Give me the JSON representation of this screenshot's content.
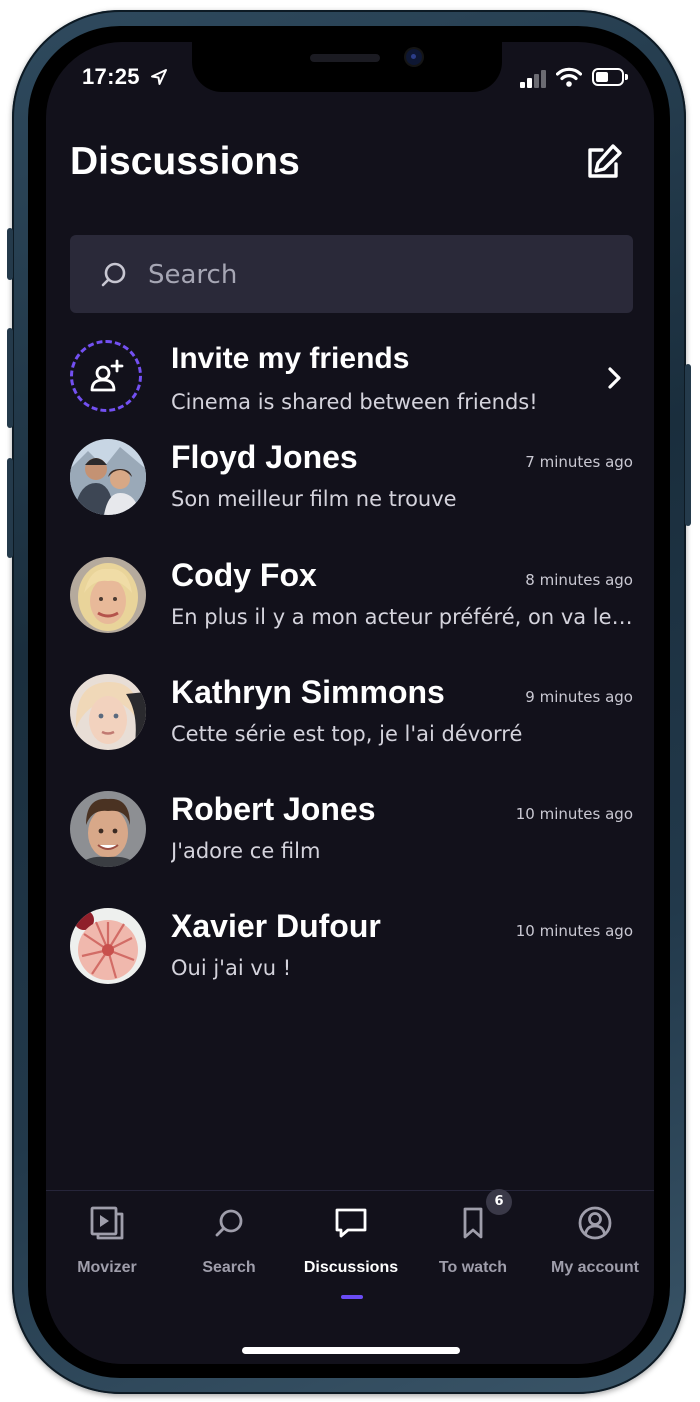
{
  "status_bar": {
    "time": "17:25"
  },
  "header": {
    "title": "Discussions"
  },
  "search": {
    "placeholder": "Search"
  },
  "invite": {
    "title": "Invite my friends",
    "subtitle": "Cinema is shared between friends!"
  },
  "conversations": [
    {
      "name": "Floyd Jones",
      "time": "7 minutes ago",
      "message": "Son meilleur film ne trouve"
    },
    {
      "name": "Cody Fox",
      "time": "8 minutes ago",
      "message": "En plus il y a mon acteur préféré, on va le voir ensemble ?"
    },
    {
      "name": "Kathryn Simmons",
      "time": "9 minutes ago",
      "message": "Cette série est top, je l'ai dévorré"
    },
    {
      "name": "Robert Jones",
      "time": "10 minutes ago",
      "message": "J'adore ce film"
    },
    {
      "name": "Xavier Dufour",
      "time": "10 minutes ago",
      "message": "Oui j'ai vu !"
    }
  ],
  "tabbar": {
    "tabs": [
      {
        "label": "Movizer",
        "icon": "play-square-icon"
      },
      {
        "label": "Search",
        "icon": "search-icon"
      },
      {
        "label": "Discussions",
        "icon": "chat-icon",
        "active": true
      },
      {
        "label": "To watch",
        "icon": "bookmark-icon",
        "badge": "6"
      },
      {
        "label": "My account",
        "icon": "user-circle-icon"
      }
    ]
  },
  "colors": {
    "background": "#12111b",
    "search_bg": "#2a2939",
    "accent": "#6a4cf5",
    "text_muted": "#d4d3dc",
    "tab_inactive": "#9f9eab"
  }
}
